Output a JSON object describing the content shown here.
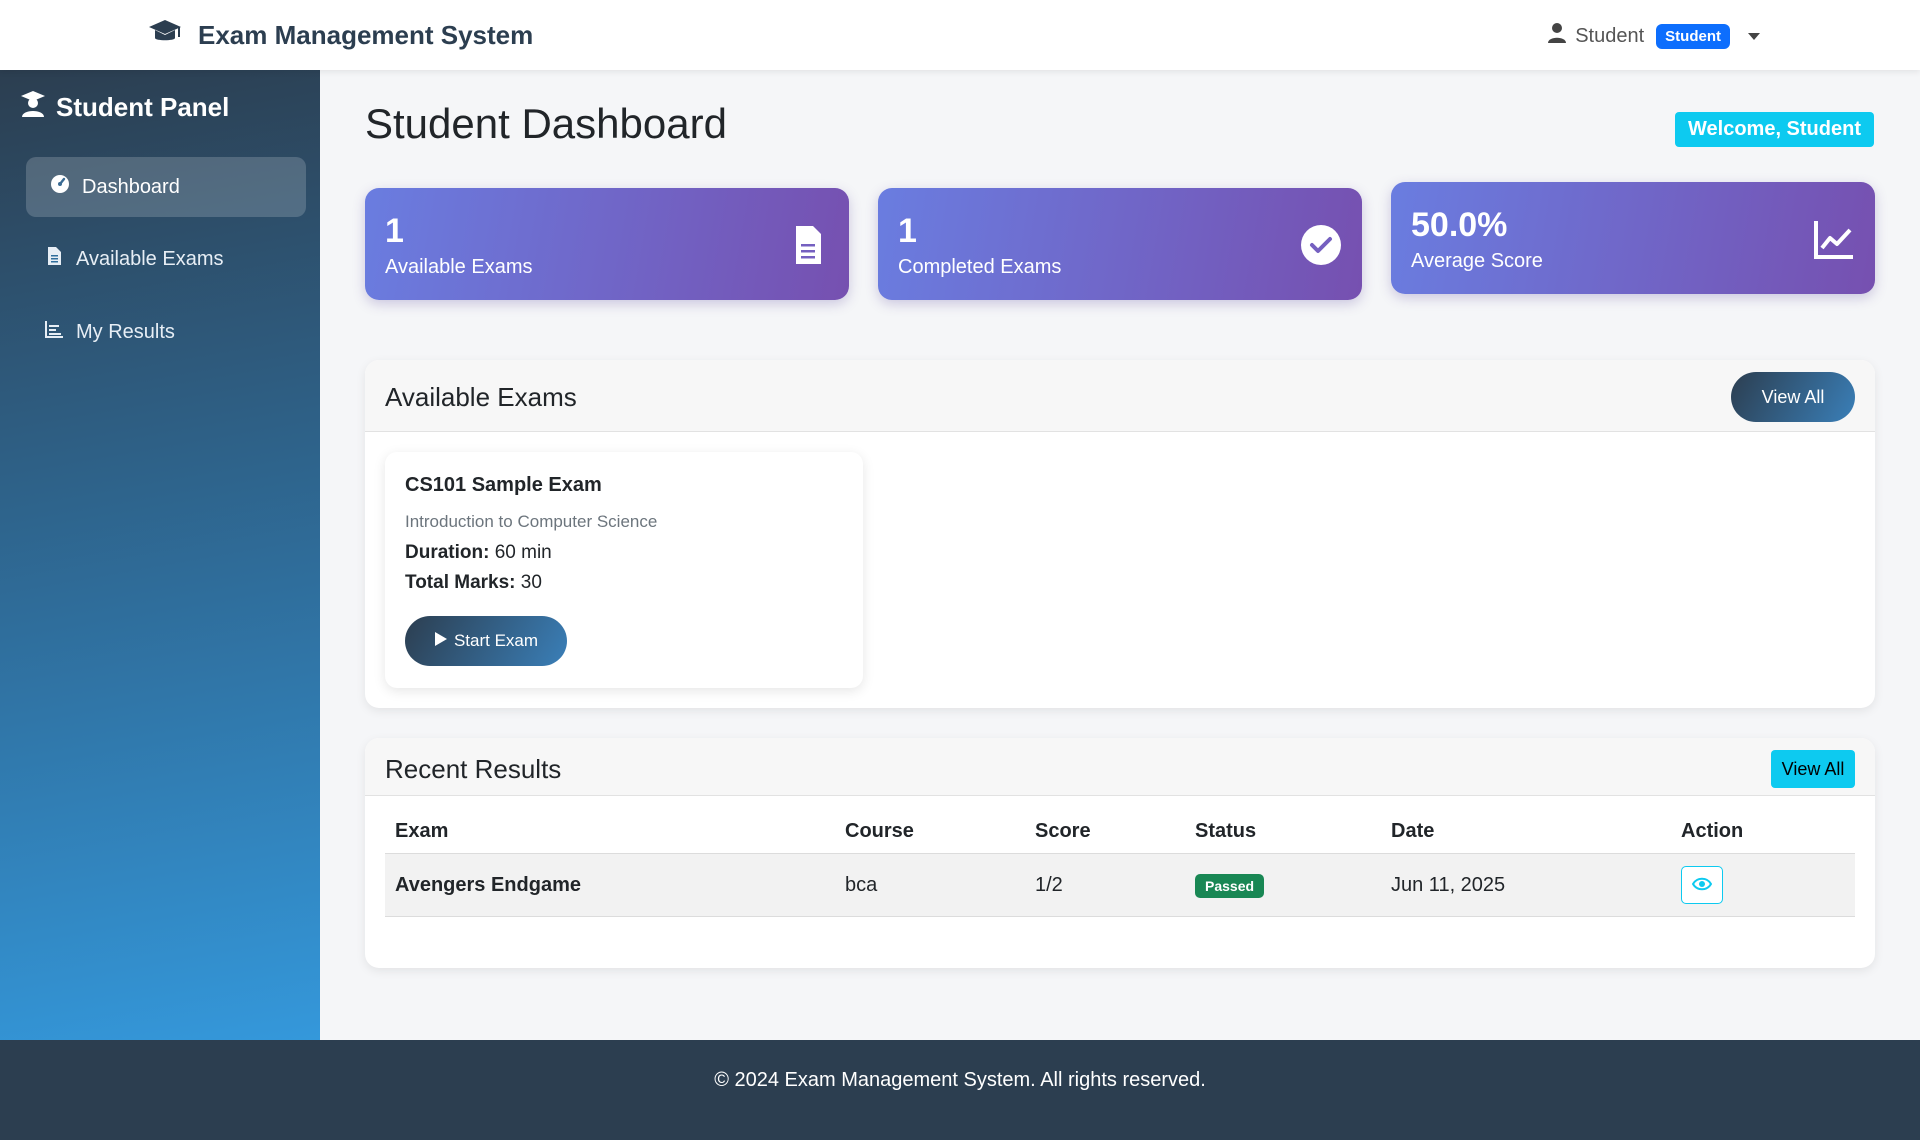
{
  "navbar": {
    "brand": "Exam Management System",
    "user_name": "Student",
    "role_badge": "Student"
  },
  "sidebar": {
    "title": "Student Panel",
    "items": [
      {
        "label": "Dashboard",
        "icon": "gauge-icon",
        "active": true
      },
      {
        "label": "Available Exams",
        "icon": "file-icon",
        "active": false
      },
      {
        "label": "My Results",
        "icon": "chart-icon",
        "active": false
      }
    ]
  },
  "main": {
    "title": "Student Dashboard",
    "welcome": "Welcome, Student",
    "stats": [
      {
        "value": "1",
        "label": "Available Exams",
        "icon": "file-icon"
      },
      {
        "value": "1",
        "label": "Completed Exams",
        "icon": "check-circle-icon"
      },
      {
        "value": "50.0%",
        "label": "Average Score",
        "icon": "line-chart-icon"
      }
    ],
    "available_exams": {
      "title": "Available Exams",
      "view_all": "View All",
      "exams": [
        {
          "name": "CS101 Sample Exam",
          "course": "Introduction to Computer Science",
          "duration_label": "Duration:",
          "duration": "60 min",
          "marks_label": "Total Marks:",
          "marks": "30",
          "start": "Start Exam"
        }
      ]
    },
    "recent_results": {
      "title": "Recent Results",
      "view_all": "View All",
      "columns": [
        "Exam",
        "Course",
        "Score",
        "Status",
        "Date",
        "Action"
      ],
      "rows": [
        {
          "exam": "Avengers Endgame",
          "course": "bca",
          "score": "1/2",
          "status": "Passed",
          "date": "Jun 11, 2025"
        }
      ]
    }
  },
  "footer": {
    "text": "© 2024 Exam Management System. All rights reserved."
  },
  "colors": {
    "primary_dark": "#2c3e50",
    "accent_blue": "#3498db",
    "card_gradient_start": "#6a7de0",
    "card_gradient_end": "#7650b0",
    "info": "#0dcaf0",
    "success": "#198754",
    "badge_blue": "#0d6efd"
  }
}
